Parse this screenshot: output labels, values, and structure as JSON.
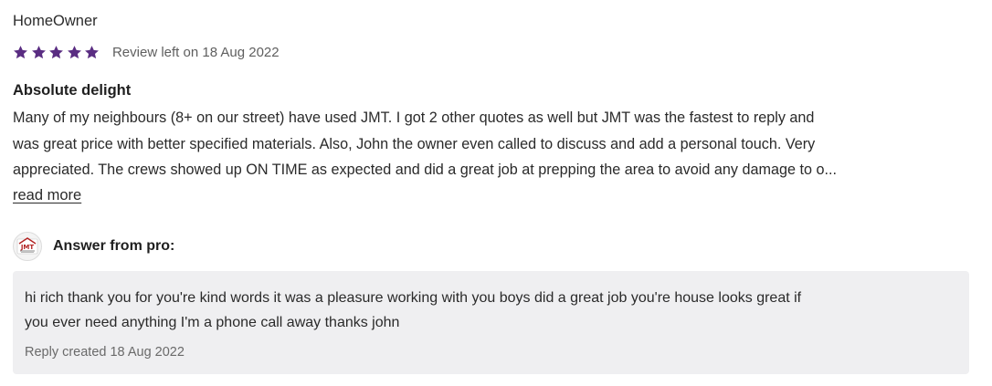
{
  "review": {
    "author": "HomeOwner",
    "rating": 5,
    "rating_max": 5,
    "star_color": "#5a2d82",
    "date_label": "Review left on 18 Aug 2022",
    "title": "Absolute delight",
    "body_lines": [
      "Many of my neighbours (8+ on our street) have used JMT. I got 2 other quotes as well but JMT was the fastest to reply and",
      "was great price with better specified materials. Also, John the owner even called to discuss and add a personal touch. Very",
      "appreciated.  The crews showed up ON TIME as expected and did a great job at prepping the area to avoid any damage to o..."
    ],
    "read_more_label": "read more"
  },
  "answer": {
    "logo_icon": "jmt-roofing-logo",
    "logo_text": "JMT",
    "label": "Answer from pro:",
    "reply_lines": [
      "hi rich thank you for you're kind words it was a pleasure working with you boys did a great job you're house looks great if",
      "you ever need anything I'm a phone call away thanks john"
    ],
    "reply_date_label": "Reply created 18 Aug 2022",
    "box_color": "#efeff1"
  }
}
